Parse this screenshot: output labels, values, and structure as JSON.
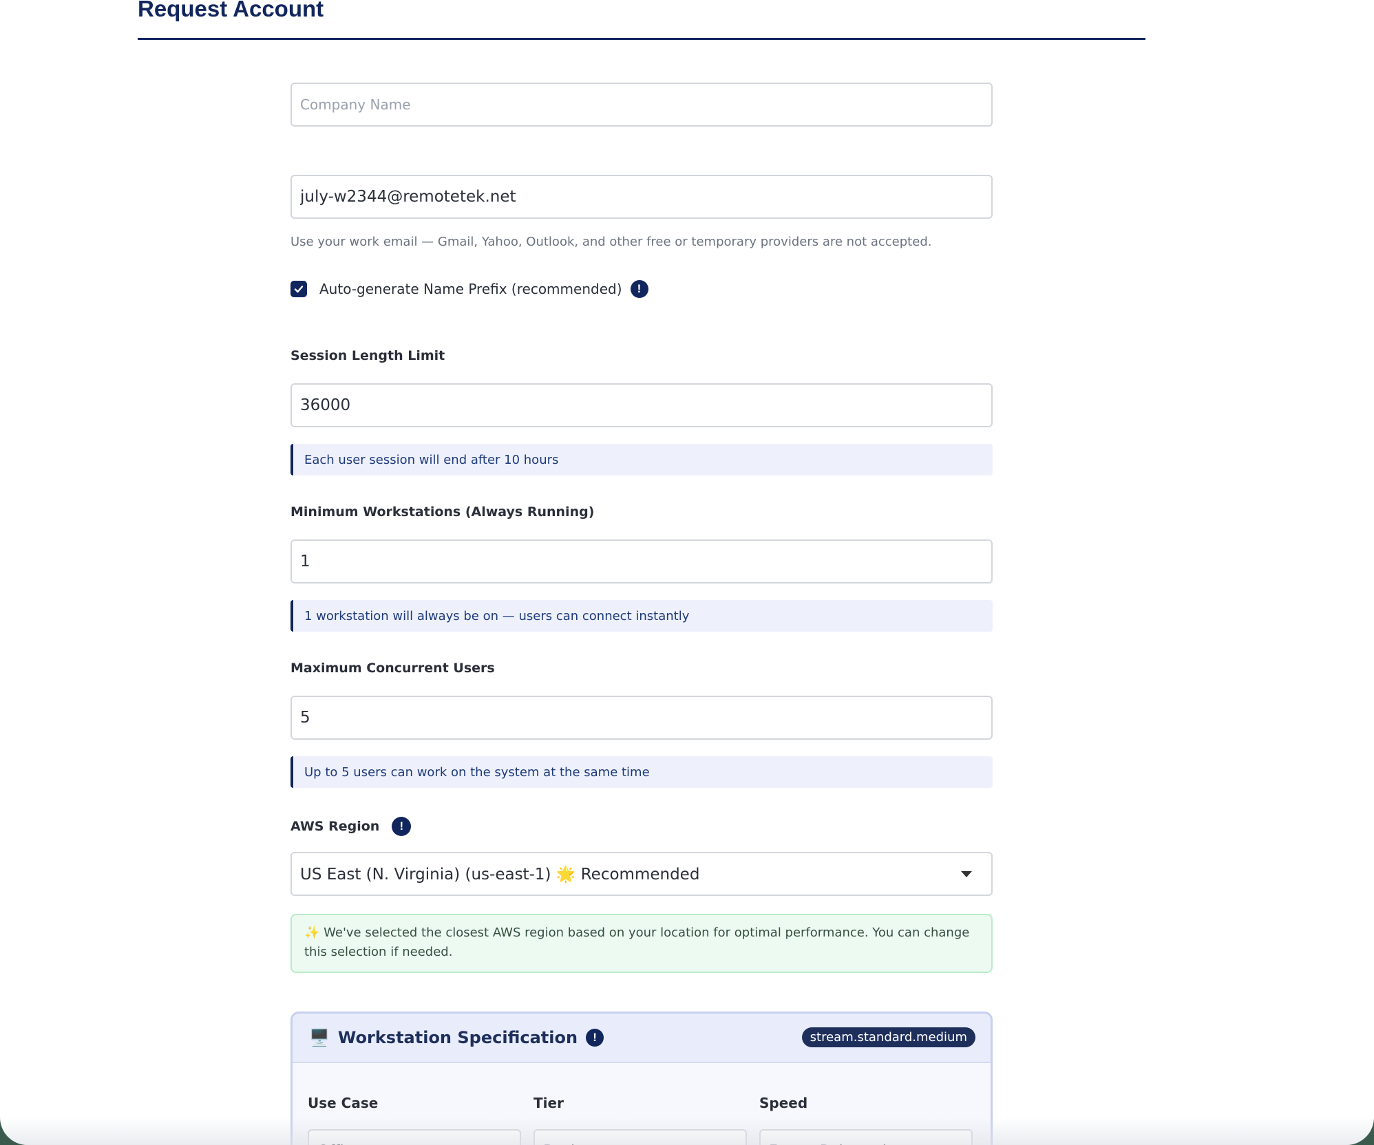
{
  "header": {
    "title": "Request Account"
  },
  "company": {
    "placeholder": "Company Name",
    "value": ""
  },
  "email": {
    "value": "july-w2344@remotetek.net",
    "hint": "Use your work email — Gmail, Yahoo, Outlook, and other free or temporary providers are not accepted."
  },
  "auto_prefix": {
    "label": "Auto-generate Name Prefix (recommended)",
    "checked": true,
    "info": "!"
  },
  "session": {
    "label": "Session Length Limit",
    "value": "36000",
    "note": "Each user session will end after 10 hours"
  },
  "min_workstations": {
    "label": "Minimum Workstations (Always Running)",
    "value": "1",
    "note": "1 workstation will always be on — users can connect instantly"
  },
  "max_users": {
    "label": "Maximum Concurrent Users",
    "value": "5",
    "note": "Up to 5 users can work on the system at the same time"
  },
  "region": {
    "label": "AWS Region",
    "info": "!",
    "selected": "US East (N. Virginia) (us-east-1) 🌟 Recommended",
    "note": "✨ We've selected the closest AWS region based on your location for optimal performance. You can change this selection if needed."
  },
  "spec": {
    "icon": "🖥️",
    "title": "Workstation Specification",
    "info": "!",
    "badge": "stream.standard.medium",
    "columns": [
      {
        "label": "Use Case",
        "value": "Office"
      },
      {
        "label": "Tier",
        "value": "Basic"
      },
      {
        "label": "Speed",
        "value": "Faster Rebound"
      }
    ]
  },
  "colors": {
    "primary": "#12265e",
    "note_bg": "#eef1fc",
    "success_bg": "#edfaf1",
    "success_border": "#b9ecc9"
  }
}
